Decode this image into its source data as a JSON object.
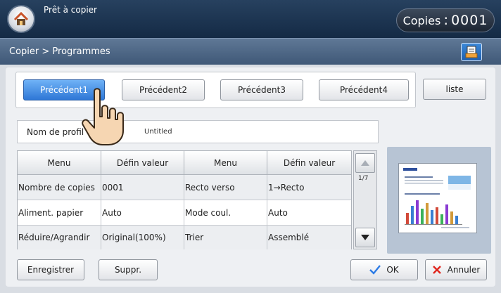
{
  "status": {
    "text": "Prêt à copier",
    "copies_label": "Copies",
    "copies_sep": ":",
    "copies_value": "0001"
  },
  "breadcrumb": "Copier > Programmes",
  "presets": [
    {
      "label": "Précédent1",
      "active": true
    },
    {
      "label": "Précédent2",
      "active": false
    },
    {
      "label": "Précédent3",
      "active": false
    },
    {
      "label": "Précédent4",
      "active": false
    }
  ],
  "list_button": "liste",
  "profile": {
    "label": "Nom de profil",
    "value": "Untitled"
  },
  "table": {
    "headers": [
      "Menu",
      "Défin valeur",
      "Menu",
      "Défin valeur"
    ],
    "rows": [
      [
        "Nombre de copies",
        "0001",
        "Recto verso",
        "1→Recto"
      ],
      [
        "Aliment. papier",
        "Auto",
        "Mode coul.",
        "Auto"
      ],
      [
        "Réduire/Agrandir",
        "Original(100%)",
        "Trier",
        "Assemblé"
      ]
    ]
  },
  "pager": {
    "indicator": "1/7"
  },
  "buttons": {
    "save": "Enregistrer",
    "delete": "Suppr.",
    "ok": "OK",
    "cancel": "Annuler"
  },
  "icons": {
    "home": "home-icon",
    "document": "document-settings-icon",
    "ok": "checkmark-icon",
    "cancel": "x-icon",
    "scroll_up": "triangle-up-icon",
    "scroll_down": "triangle-down-icon",
    "pointer": "hand-pointer-icon"
  },
  "colors": {
    "active_button": "#3a86e0",
    "ok_check": "#2c7be5",
    "cancel_x": "#e0241b"
  }
}
